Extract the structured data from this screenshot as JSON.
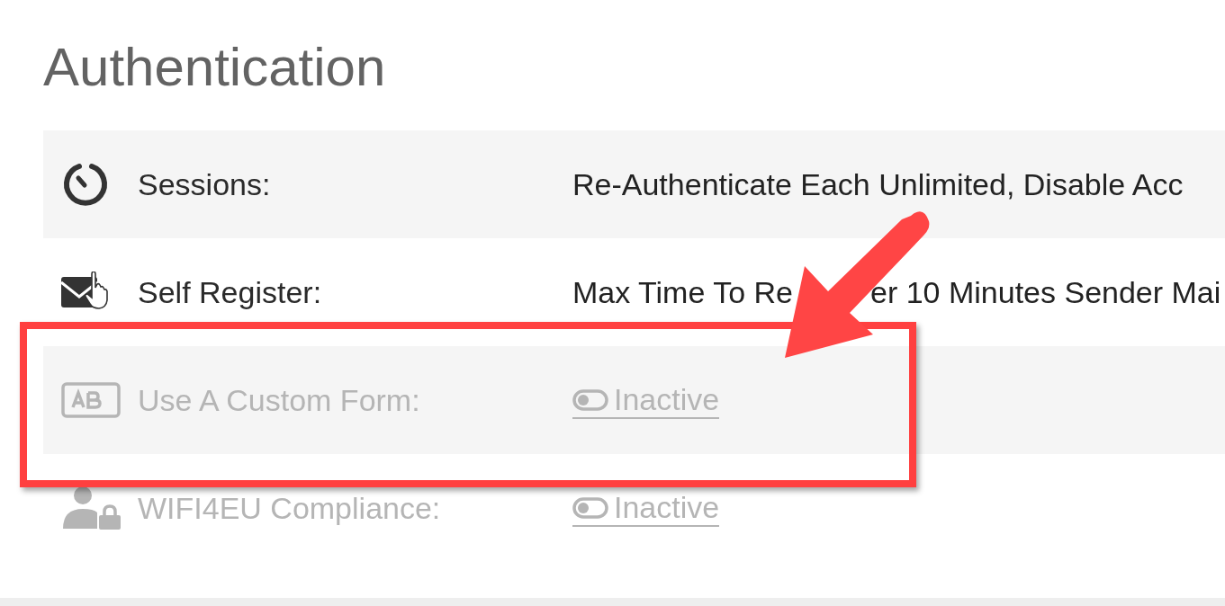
{
  "title": "Authentication",
  "rows": [
    {
      "kind": "timer",
      "label": "Sessions:",
      "disabled": false,
      "value": {
        "kind": "text",
        "parts": [
          "Re-Authenticate Each Unlimited, Disable Acc"
        ]
      }
    },
    {
      "kind": "envelope",
      "label": "Self Register:",
      "disabled": false,
      "value": {
        "kind": "text",
        "parts": [
          "Max Time To Re",
          "er 10 Minutes Sender Mai"
        ]
      }
    },
    {
      "kind": "form",
      "label": "Use A Custom Form:",
      "disabled": true,
      "value": {
        "kind": "toggle",
        "text": "Inactive",
        "on": false
      }
    },
    {
      "kind": "user-lock",
      "label": "WIFI4EU Compliance:",
      "disabled": true,
      "value": {
        "kind": "toggle",
        "text": "Inactive",
        "on": false
      }
    }
  ]
}
